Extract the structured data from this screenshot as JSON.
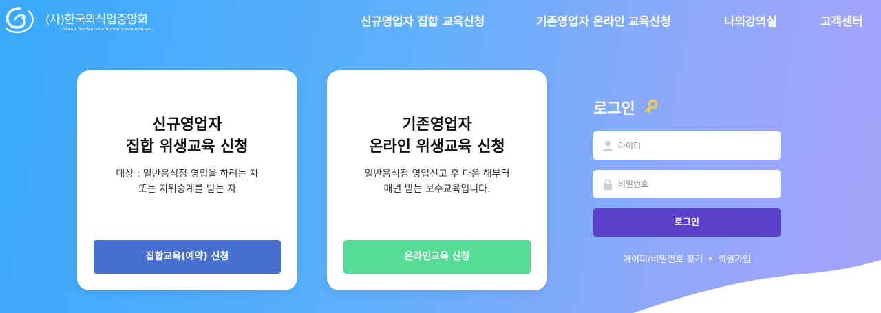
{
  "header": {
    "logo_title": "(사)한국외식업중앙회",
    "logo_subtitle": "Korea Foodservice Industry Association",
    "nav": [
      "신규영업자 집합 교육신청",
      "기존영업자 온라인 교육신청",
      "나의강의실",
      "고객센터"
    ]
  },
  "cards": [
    {
      "title_line1": "신규영업자",
      "title_line2": "집합 위생교육 신청",
      "desc_line1": "대상 : 일반음식점 영업을 하려는 자",
      "desc_line2": "또는 지위승계를 받는 자",
      "button": "집합교육(예약) 신청",
      "button_color": "#466fd0"
    },
    {
      "title_line1": "기존영업자",
      "title_line2": "온라인 위생교육 신청",
      "desc_line1": "일반음식점 영업신고 후 다음 해부터",
      "desc_line2": "매년 받는 보수교육입니다.",
      "button": "온라인교육 신청",
      "button_color": "#57dc98"
    }
  ],
  "login": {
    "title": "로그인",
    "id_placeholder": "아이디",
    "pw_placeholder": "비밀번호",
    "button": "로그인",
    "find_link": "아이디/비밀번호 찾기",
    "separator": "•",
    "signup_link": "회원가입",
    "button_color": "#5b3fc9",
    "key_icon_color": "#f6d33a"
  }
}
